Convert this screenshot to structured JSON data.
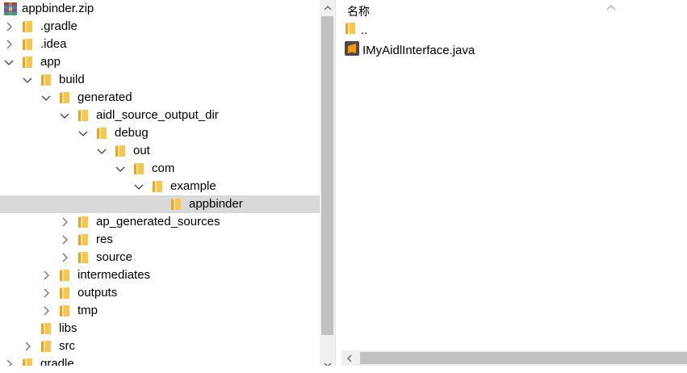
{
  "tree": {
    "items": [
      {
        "label": "appbinder.zip",
        "level": 0,
        "icon": "winrar-archive-icon",
        "chevron": "none"
      },
      {
        "label": ".gradle",
        "level": 0,
        "icon": "folder-icon",
        "chevron": "collapsed"
      },
      {
        "label": ".idea",
        "level": 0,
        "icon": "folder-icon",
        "chevron": "collapsed"
      },
      {
        "label": "app",
        "level": 0,
        "icon": "folder-icon",
        "chevron": "expanded"
      },
      {
        "label": "build",
        "level": 1,
        "icon": "folder-icon",
        "chevron": "expanded"
      },
      {
        "label": "generated",
        "level": 2,
        "icon": "folder-icon",
        "chevron": "expanded"
      },
      {
        "label": "aidl_source_output_dir",
        "level": 3,
        "icon": "folder-icon",
        "chevron": "expanded"
      },
      {
        "label": "debug",
        "level": 4,
        "icon": "folder-icon",
        "chevron": "expanded"
      },
      {
        "label": "out",
        "level": 5,
        "icon": "folder-icon",
        "chevron": "expanded"
      },
      {
        "label": "com",
        "level": 6,
        "icon": "folder-icon",
        "chevron": "expanded"
      },
      {
        "label": "example",
        "level": 7,
        "icon": "folder-icon",
        "chevron": "expanded"
      },
      {
        "label": "appbinder",
        "level": 8,
        "icon": "folder-icon",
        "chevron": "none",
        "selected": true
      },
      {
        "label": "ap_generated_sources",
        "level": 3,
        "icon": "folder-icon",
        "chevron": "collapsed"
      },
      {
        "label": "res",
        "level": 3,
        "icon": "folder-icon",
        "chevron": "collapsed"
      },
      {
        "label": "source",
        "level": 3,
        "icon": "folder-icon",
        "chevron": "collapsed"
      },
      {
        "label": "intermediates",
        "level": 2,
        "icon": "folder-icon",
        "chevron": "collapsed"
      },
      {
        "label": "outputs",
        "level": 2,
        "icon": "folder-icon",
        "chevron": "collapsed"
      },
      {
        "label": "tmp",
        "level": 2,
        "icon": "folder-icon",
        "chevron": "collapsed"
      },
      {
        "label": "libs",
        "level": 1,
        "icon": "folder-icon",
        "chevron": "none"
      },
      {
        "label": "src",
        "level": 1,
        "icon": "folder-icon",
        "chevron": "collapsed"
      },
      {
        "label": "gradle",
        "level": 0,
        "icon": "folder-icon",
        "chevron": "collapsed"
      }
    ]
  },
  "list": {
    "column_header": "名称",
    "files": [
      {
        "label": "..",
        "icon": "folder-icon"
      },
      {
        "label": "IMyAidlInterface.java",
        "icon": "sublime-text-icon"
      }
    ]
  },
  "colors": {
    "selected_row": "#d9d9d9",
    "folder": "#f6c64f",
    "scroll_thumb": "#c1c1c1",
    "scroll_track": "#f0f0f0"
  }
}
